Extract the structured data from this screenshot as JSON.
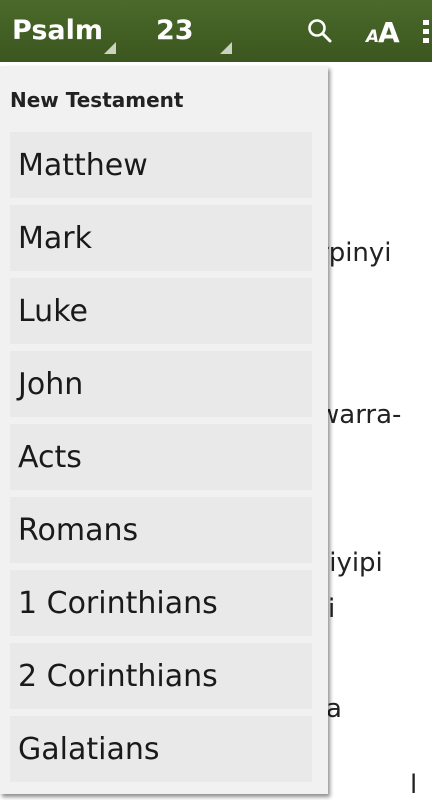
{
  "toolbar": {
    "book": "Psalm",
    "chapter": "23"
  },
  "reading_fragments": [
    "rpinyi",
    "warra-",
    "jiyipi",
    "i",
    "a",
    "l"
  ],
  "dropdown": {
    "section_header": "New Testament",
    "books": [
      "Matthew",
      "Mark",
      "Luke",
      "John",
      "Acts",
      "Romans",
      "1 Corinthians",
      "2 Corinthians",
      "Galatians"
    ]
  },
  "icons": {
    "search": "search-icon",
    "text_size": "text-size-icon",
    "overflow": "overflow-menu-icon"
  },
  "colors": {
    "toolbar": "#3f5b22",
    "dropdown_bg": "#f1f1f1",
    "item_bg": "#e9e9e9"
  }
}
